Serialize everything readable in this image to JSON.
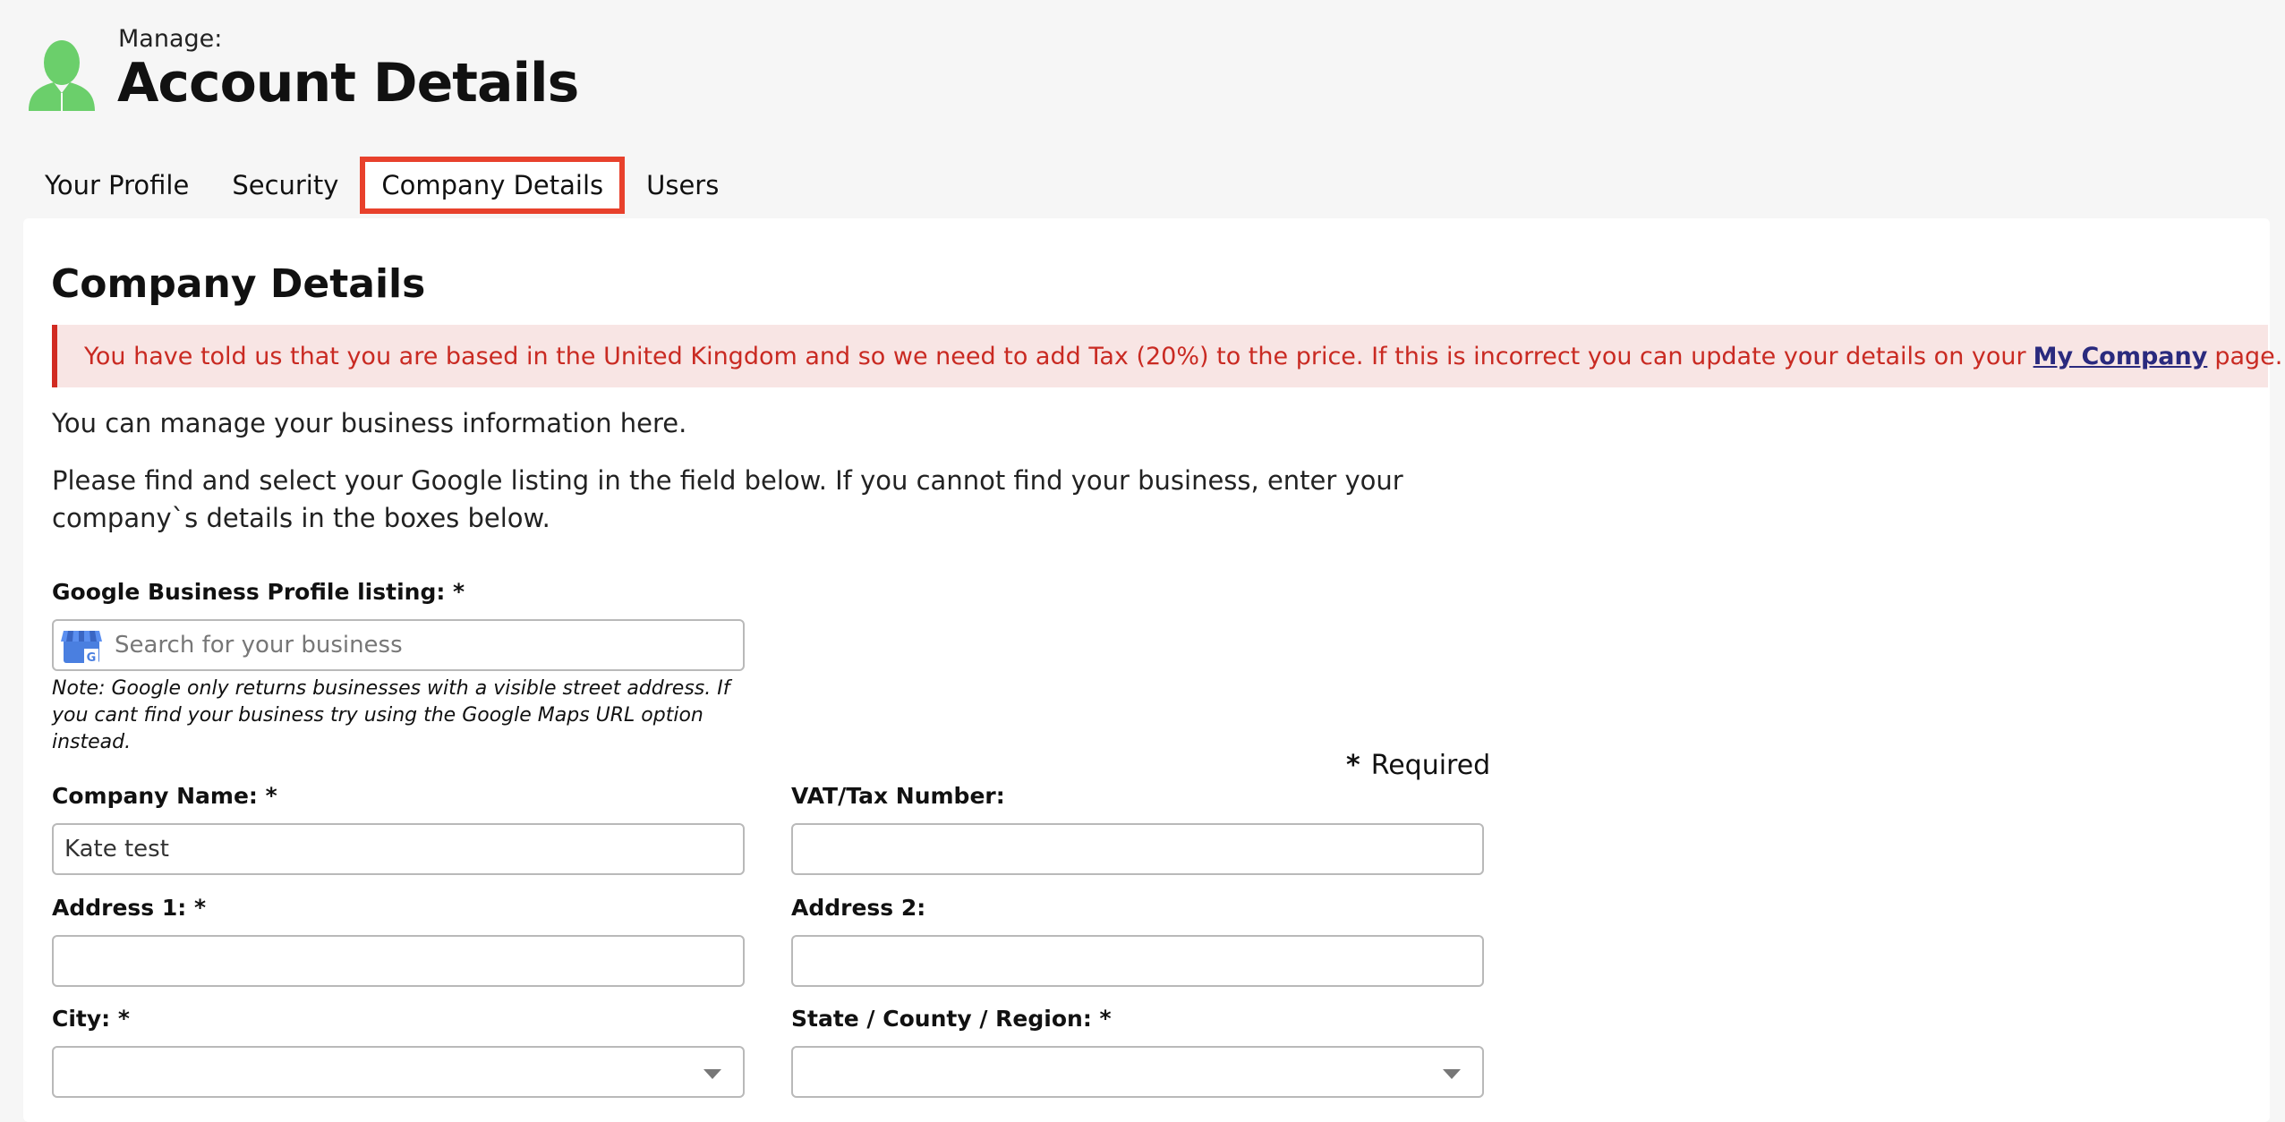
{
  "header": {
    "manage_label": "Manage:",
    "title": "Account Details",
    "avatar_icon": "user-avatar-icon",
    "avatar_color": "#6bcf6b"
  },
  "tabs": [
    {
      "label": "Your Profile",
      "active": false
    },
    {
      "label": "Security",
      "active": false
    },
    {
      "label": "Company Details",
      "active": true
    },
    {
      "label": "Users",
      "active": false
    }
  ],
  "panel": {
    "title": "Company Details",
    "alert": {
      "flag_icon": "uk-flag-icon",
      "text_before": "You have told us that you are based in the United Kingdom and so we need to add Tax (20%) to the price. If this is incorrect you can update your details on your",
      "link_text": "My Company",
      "text_after": "page.",
      "color": "#c92a22",
      "background": "#f8e5e4"
    },
    "intro1": "You can manage your business information here.",
    "intro2": "Please find and select your Google listing in the field below. If you cannot find your business, enter your company`s details in the boxes below.",
    "gbp": {
      "label": "Google Business Profile listing: *",
      "placeholder": "Search for your business",
      "icon": "google-business-icon",
      "note": "Note: Google only returns businesses with a visible street address. If you cant find your business try using the Google Maps URL option instead."
    },
    "required_marker": "*",
    "required_text": "Required",
    "fields": {
      "company_name": {
        "label": "Company Name: *",
        "value": "Kate test"
      },
      "vat": {
        "label": "VAT/Tax Number:",
        "value": ""
      },
      "address1": {
        "label": "Address 1: *",
        "value": ""
      },
      "address2": {
        "label": "Address 2:",
        "value": ""
      },
      "city": {
        "label": "City: *",
        "value": ""
      },
      "region": {
        "label": "State / County / Region: *",
        "value": ""
      }
    }
  }
}
